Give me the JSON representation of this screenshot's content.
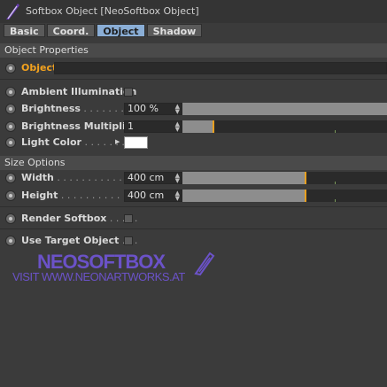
{
  "window": {
    "title": "Softbox Object [NeoSoftbox Object]",
    "icon": "neosoftbox-feather-icon"
  },
  "tabs": [
    {
      "label": "Basic",
      "active": false
    },
    {
      "label": "Coord.",
      "active": false
    },
    {
      "label": "Object",
      "active": true
    },
    {
      "label": "Shadow",
      "active": false
    }
  ],
  "object_properties": {
    "header": "Object Properties",
    "object": {
      "label": "Object",
      "value": ""
    },
    "ambient_illumination": {
      "label": "Ambient Illumination",
      "checked": false
    },
    "brightness": {
      "label": "Brightness",
      "dots": " . . . . . . . . . .",
      "value": "100 %",
      "slider_fraction": 1.0
    },
    "brightness_multiplier": {
      "label": "Brightness Multiplier",
      "value": "1",
      "slider_fraction": 0.15
    },
    "light_color": {
      "label": "Light Color",
      "dots": " . . . . . . .",
      "color": "#ffffff"
    }
  },
  "size_options": {
    "header": "Size Options",
    "width": {
      "label": "Width",
      "dots": " . . . . . . . . . . . . .",
      "value": "400 cm",
      "slider_fraction": 0.6
    },
    "height": {
      "label": "Height",
      "dots": " . . . . . . . . . . . . .",
      "value": "400 cm",
      "slider_fraction": 0.6
    },
    "render_softbox": {
      "label": "Render Softbox",
      "dots": " . . . . .",
      "checked": false
    },
    "use_target_object": {
      "label": "Use Target Object",
      "dots": " . . .",
      "checked": false
    }
  },
  "watermark": {
    "title": "NEOSOFTBOX",
    "url": "VISIT WWW.NEONARTWORKS.AT"
  },
  "colors": {
    "accent": "#f3a21e",
    "tab_active": "#8aaed6",
    "slider_knob": "#e8a020",
    "watermark": "#6b52c8"
  }
}
